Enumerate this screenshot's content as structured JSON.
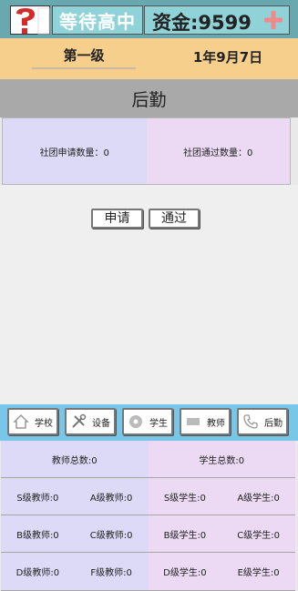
{
  "header": {
    "status": "等待高中",
    "fund_label": "资金:9599",
    "level": "第一级",
    "date": "1年9月7日"
  },
  "section": {
    "title": "后勤",
    "applications": "社团申请数量：0",
    "approved": "社团通过数量：0"
  },
  "actions": {
    "apply": "申请",
    "approve": "通过"
  },
  "nav": [
    {
      "label": "学校",
      "icon": "home-icon"
    },
    {
      "label": "设备",
      "icon": "tools-icon"
    },
    {
      "label": "学生",
      "icon": "disc-icon"
    },
    {
      "label": "教师",
      "icon": "card-icon"
    },
    {
      "label": "后勤",
      "icon": "phone-icon"
    }
  ],
  "stats": {
    "teacher_total": "教师总数:0",
    "student_total": "学生总数:0",
    "rows": [
      [
        "S级教师:0",
        "A级教师:0",
        "S级学生:0",
        "A级学生:0"
      ],
      [
        "B级教师:0",
        "C级教师:0",
        "B级学生:0",
        "C级学生:0"
      ],
      [
        "D级教师:0",
        "F级教师:0",
        "D级学生:0",
        "E级学生:0"
      ]
    ]
  },
  "colors": {
    "header_bg": "#6aa8b0",
    "level_bg": "#f6cf8d",
    "nav_bg": "#78c6e8",
    "teacher_bg": "#dcdaf6",
    "student_bg": "#ecdaf4",
    "help_mark": "#d32a2a",
    "plus": "#f08a8a"
  }
}
